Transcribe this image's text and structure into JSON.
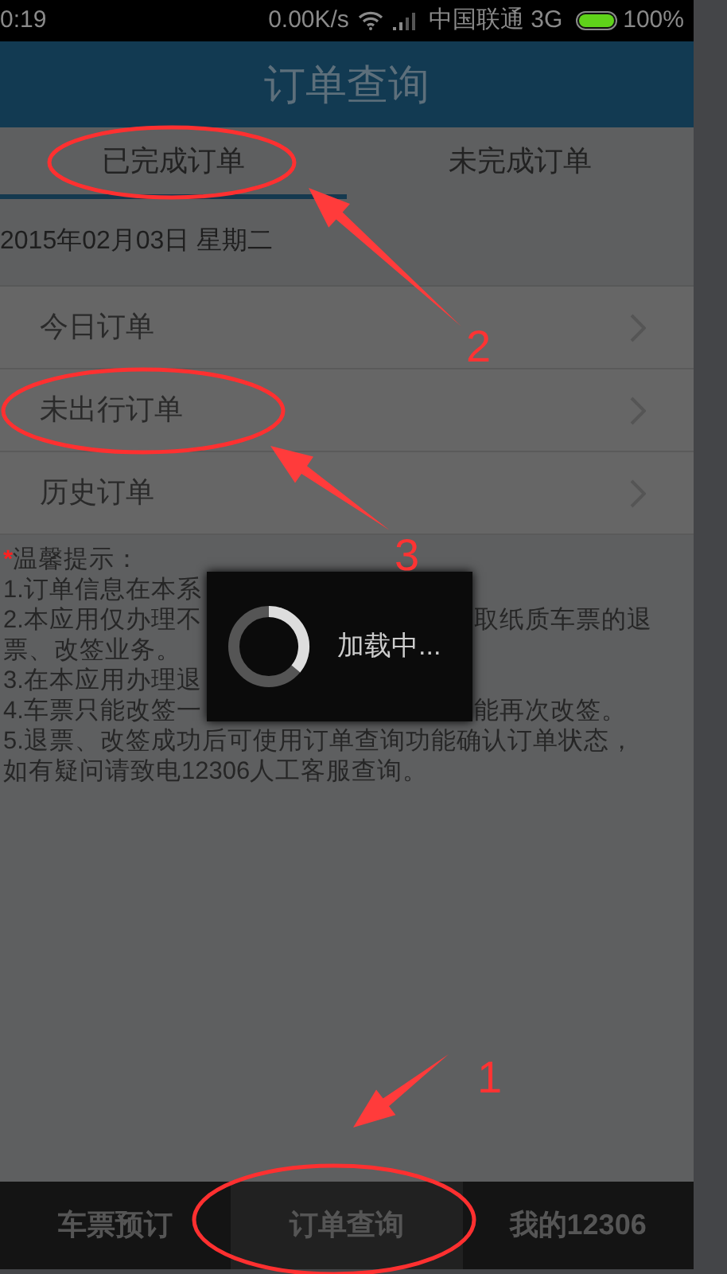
{
  "status_bar": {
    "time": "0:19",
    "net_speed": "0.00K/s",
    "carrier": "中国联通 3G",
    "battery": "100%"
  },
  "title": "订单查询",
  "tabs": [
    {
      "label": "已完成订单",
      "selected": true
    },
    {
      "label": "未完成订单",
      "selected": false
    }
  ],
  "date": "2015年02月03日 星期二",
  "menu": [
    {
      "label": "今日订单"
    },
    {
      "label": "未出行订单"
    },
    {
      "label": "历史订单"
    }
  ],
  "notice": {
    "mark": "*",
    "title": "温馨提示：",
    "lines": [
      {
        "left": "1.订单信息在本系"
      },
      {
        "left": "2.本应用仅办理不",
        "right": "取纸质车票的退"
      },
      {
        "left": "票、改签业务。"
      },
      {
        "left": "3.在本应用办理退"
      },
      {
        "left": "4.车票只能改签一",
        "right": "能再次改签。"
      },
      {
        "left": "5.退票、改签成功后可使用订单查询功能确认订单状态，"
      },
      {
        "left": "如有疑问请致电12306人工客服查询。"
      }
    ]
  },
  "loading": {
    "text": "加载中..."
  },
  "bottom_nav": [
    {
      "label": "车票预订",
      "selected": false
    },
    {
      "label": "订单查询",
      "selected": true
    },
    {
      "label": "我的12306",
      "selected": false
    }
  ],
  "annotations": [
    {
      "number": "2"
    },
    {
      "number": "3"
    },
    {
      "number": "1"
    }
  ]
}
